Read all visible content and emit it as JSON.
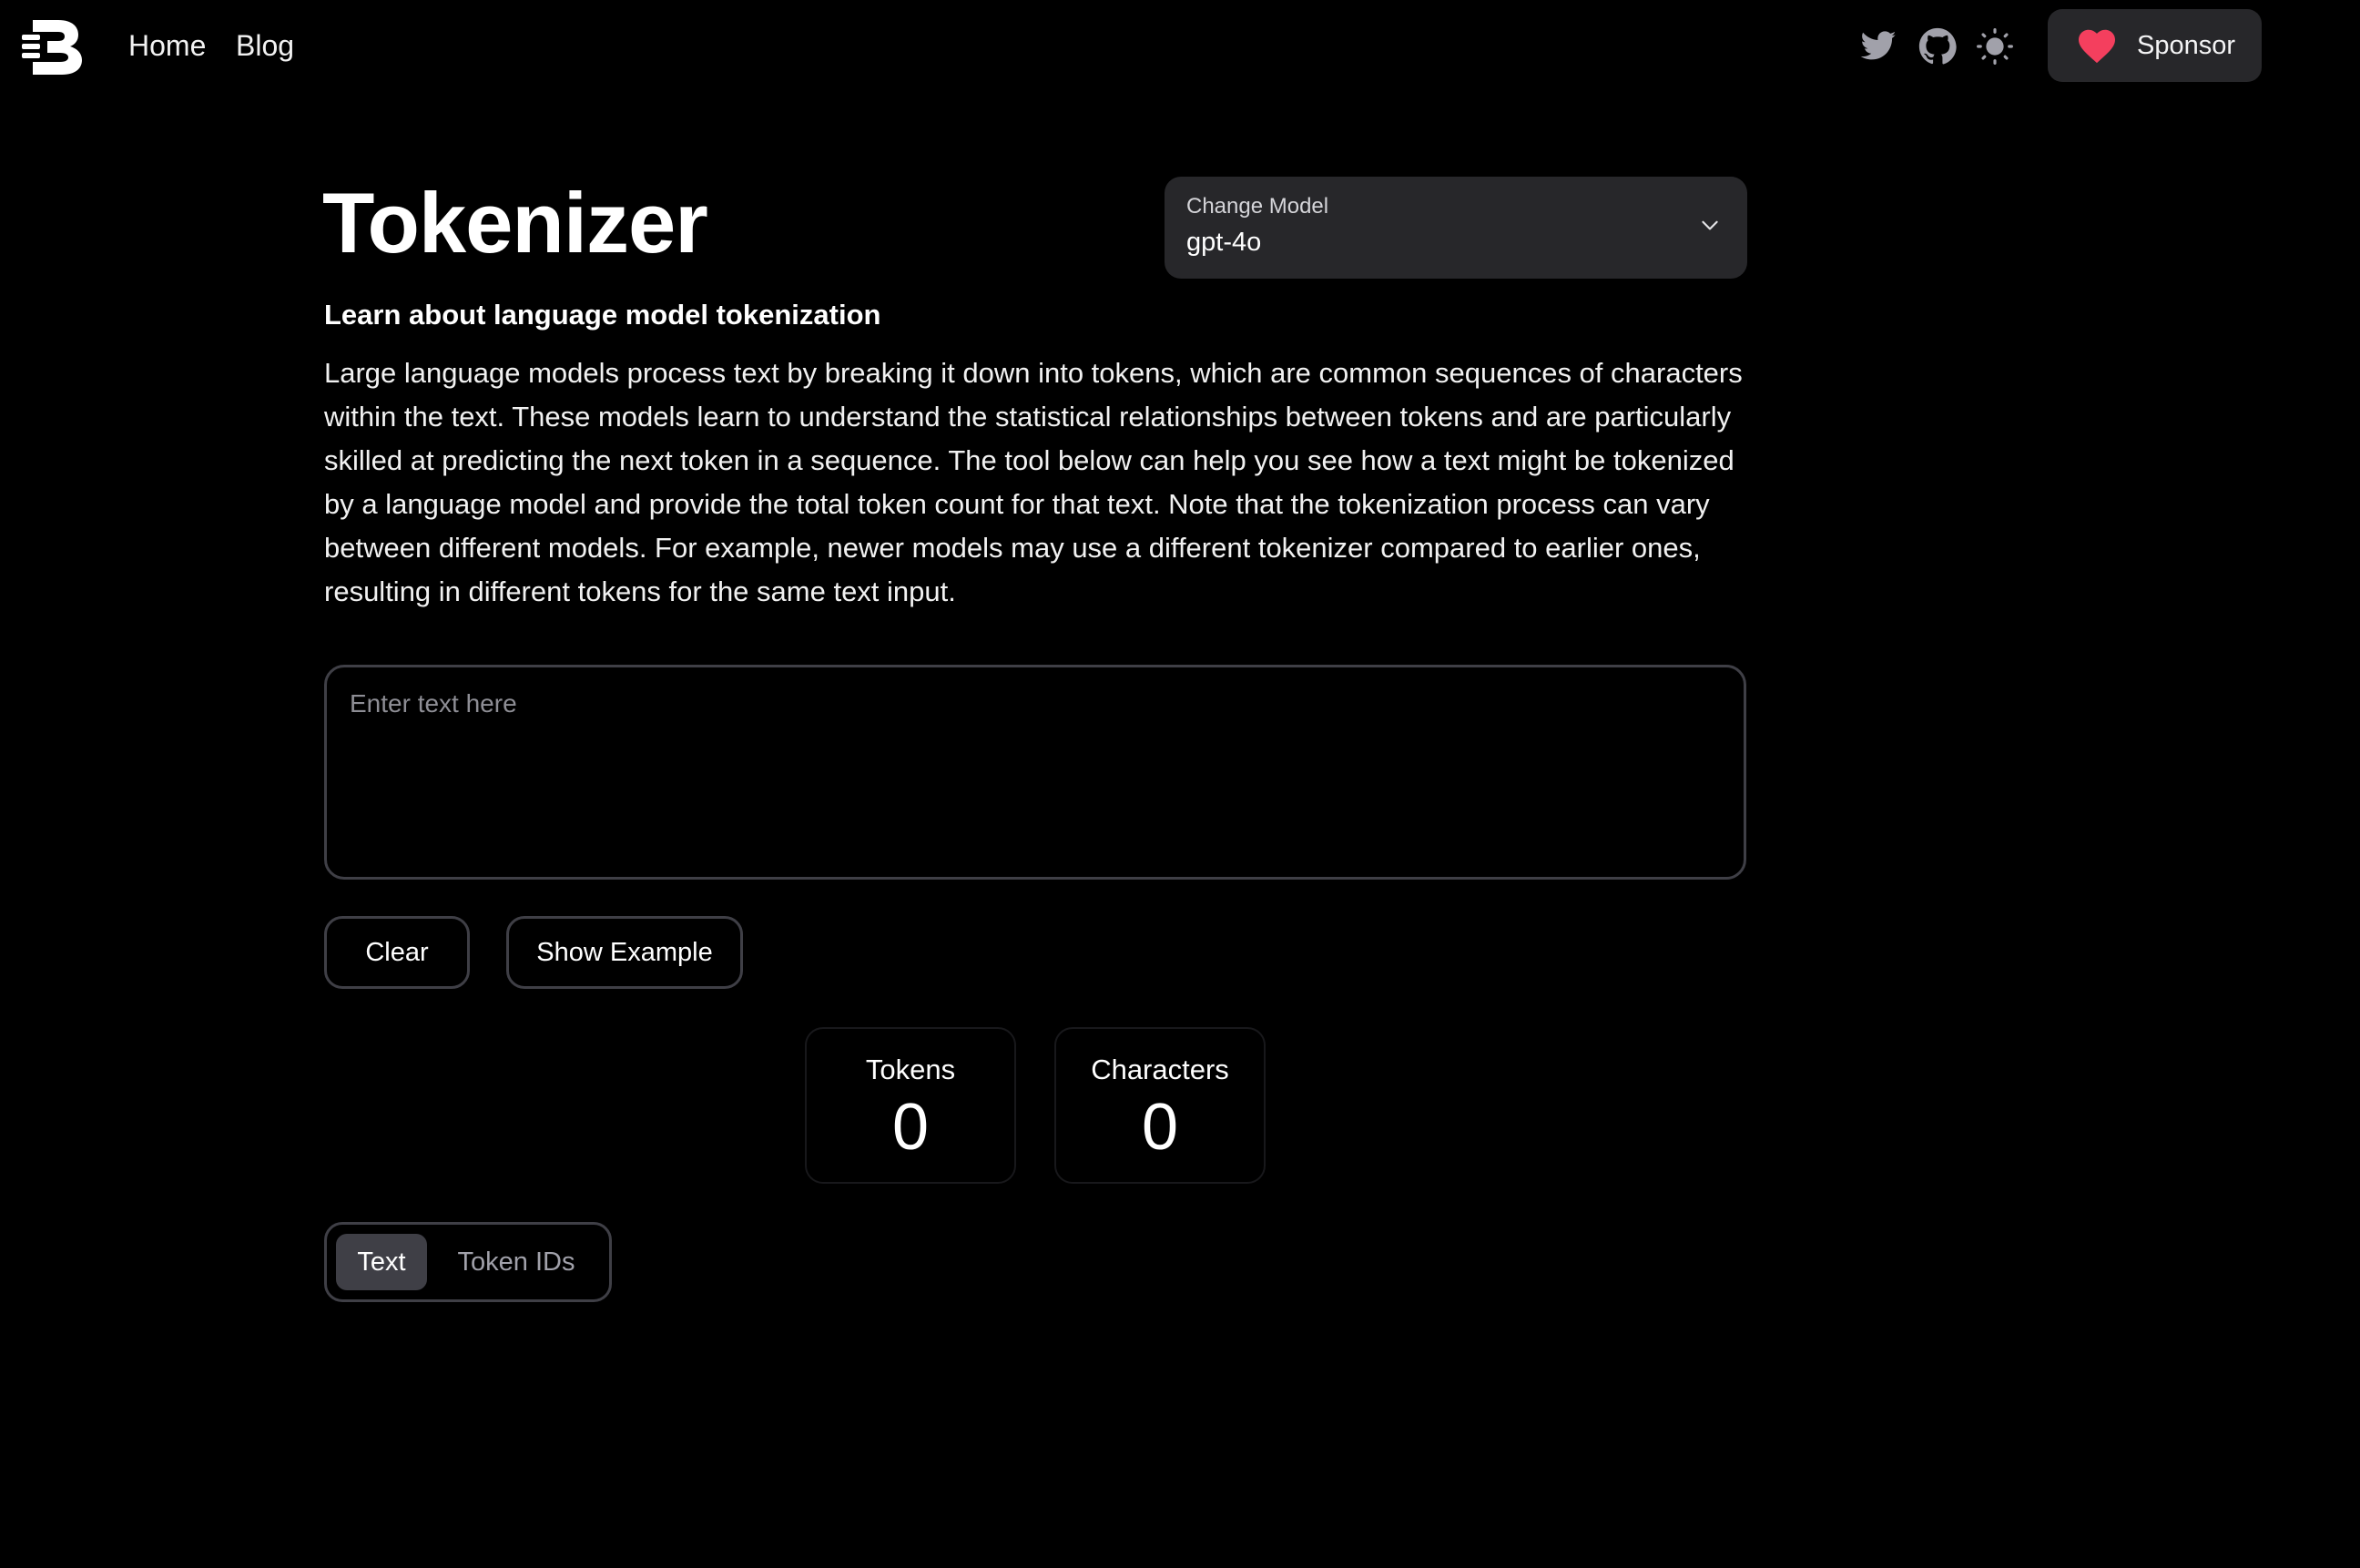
{
  "colors": {
    "background": "#000000",
    "surface": "#27272a",
    "border": "#3f3f46",
    "heart": "#f43f5e",
    "muted_text": "#a1a1aa"
  },
  "header": {
    "logo_icon": "beehiiv-style-B-logo",
    "nav": [
      {
        "label": "Home"
      },
      {
        "label": "Blog"
      }
    ],
    "icons": [
      "twitter-icon",
      "github-icon",
      "theme-toggle-sun-icon"
    ],
    "sponsor_label": "Sponsor"
  },
  "main": {
    "title": "Tokenizer",
    "model_select": {
      "label": "Change Model",
      "value": "gpt-4o"
    },
    "subtitle": "Learn about language model tokenization",
    "description": "Large language models process text by breaking it down into tokens, which are common sequences of characters within the text. These models learn to understand the statistical relationships between tokens and are particularly skilled at predicting the next token in a sequence. The tool below can help you see how a text might be tokenized by a language model and provide the total token count for that text. Note that the tokenization process can vary between different models. For example, newer models may use a different tokenizer compared to earlier ones, resulting in different tokens for the same text input.",
    "input": {
      "value": "",
      "placeholder": "Enter text here"
    },
    "buttons": {
      "clear": "Clear",
      "show_example": "Show Example"
    },
    "stats": {
      "tokens_label": "Tokens",
      "tokens_value": "0",
      "characters_label": "Characters",
      "characters_value": "0"
    },
    "view_toggle": {
      "options": [
        "Text",
        "Token IDs"
      ],
      "selected": "Text"
    }
  }
}
